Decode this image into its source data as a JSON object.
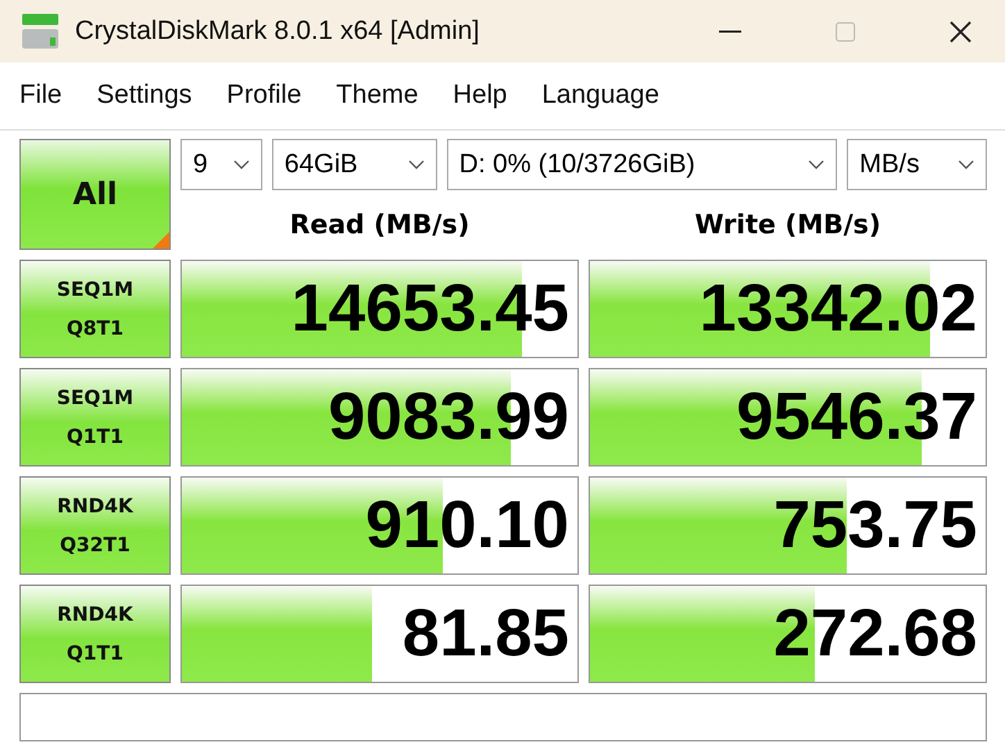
{
  "window": {
    "title": "CrystalDiskMark 8.0.1 x64 [Admin]"
  },
  "menu": [
    "File",
    "Settings",
    "Profile",
    "Theme",
    "Help",
    "Language"
  ],
  "all_button": {
    "label": "All"
  },
  "selects": [
    {
      "value": "9"
    },
    {
      "value": "64GiB"
    },
    {
      "value": "D: 0% (10/3726GiB)"
    },
    {
      "value": "MB/s"
    }
  ],
  "headers": [
    "Read (MB/s)",
    "Write (MB/s)"
  ],
  "rows": [
    {
      "test": [
        "SEQ1M",
        "Q8T1"
      ],
      "read": {
        "value": "14653.45",
        "level": 0.86
      },
      "write": {
        "value": "13342.02",
        "level": 0.86
      }
    },
    {
      "test": [
        "SEQ1M",
        "Q1T1"
      ],
      "read": {
        "value": "9083.99",
        "level": 0.83
      },
      "write": {
        "value": "9546.37",
        "level": 0.84
      }
    },
    {
      "test": [
        "RND4K",
        "Q32T1"
      ],
      "read": {
        "value": "910.10",
        "level": 0.66
      },
      "write": {
        "value": "753.75",
        "level": 0.65
      }
    },
    {
      "test": [
        "RND4K",
        "Q1T1"
      ],
      "read": {
        "value": "81.85",
        "level": 0.48
      },
      "write": {
        "value": "272.68",
        "level": 0.57
      }
    }
  ]
}
